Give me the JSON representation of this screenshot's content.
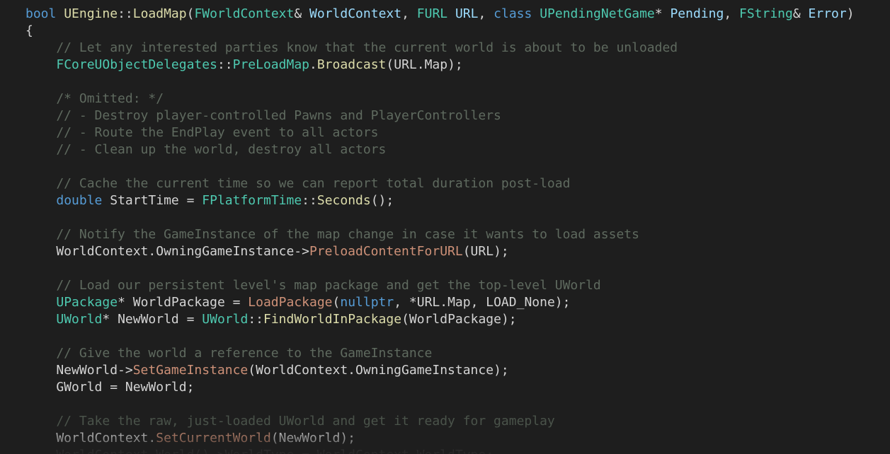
{
  "code_lines": [
    [
      {
        "t": "bool",
        "c": "kw"
      },
      {
        "t": " ",
        "c": "plain"
      },
      {
        "t": "UEngine",
        "c": "fn"
      },
      {
        "t": "::",
        "c": "plain"
      },
      {
        "t": "LoadMap",
        "c": "fn"
      },
      {
        "t": "(",
        "c": "plain"
      },
      {
        "t": "FWorldContext",
        "c": "type"
      },
      {
        "t": "& ",
        "c": "plain"
      },
      {
        "t": "WorldContext",
        "c": "param"
      },
      {
        "t": ", ",
        "c": "plain"
      },
      {
        "t": "FURL",
        "c": "type"
      },
      {
        "t": " ",
        "c": "plain"
      },
      {
        "t": "URL",
        "c": "param"
      },
      {
        "t": ", ",
        "c": "plain"
      },
      {
        "t": "class",
        "c": "kw"
      },
      {
        "t": " ",
        "c": "plain"
      },
      {
        "t": "UPendingNetGame",
        "c": "type"
      },
      {
        "t": "* ",
        "c": "plain"
      },
      {
        "t": "Pending",
        "c": "param"
      },
      {
        "t": ", ",
        "c": "plain"
      },
      {
        "t": "FString",
        "c": "type"
      },
      {
        "t": "& ",
        "c": "plain"
      },
      {
        "t": "Error",
        "c": "param"
      },
      {
        "t": ")",
        "c": "plain"
      }
    ],
    [
      {
        "t": "{",
        "c": "plain"
      }
    ],
    [
      {
        "t": "    // Let any interested parties know that the current world is about to be unloaded",
        "c": "comment"
      }
    ],
    [
      {
        "t": "    ",
        "c": "plain"
      },
      {
        "t": "FCoreUObjectDelegates",
        "c": "type"
      },
      {
        "t": "::",
        "c": "plain"
      },
      {
        "t": "PreLoadMap",
        "c": "type"
      },
      {
        "t": ".",
        "c": "plain"
      },
      {
        "t": "Broadcast",
        "c": "fn"
      },
      {
        "t": "(URL.Map);",
        "c": "plain"
      }
    ],
    [
      {
        "t": "",
        "c": "plain"
      }
    ],
    [
      {
        "t": "    /* Omitted: */",
        "c": "comment"
      }
    ],
    [
      {
        "t": "    // - Destroy player-controlled Pawns and PlayerControllers",
        "c": "comment"
      }
    ],
    [
      {
        "t": "    // - Route the EndPlay event to all actors",
        "c": "comment"
      }
    ],
    [
      {
        "t": "    // - Clean up the world, destroy all actors",
        "c": "comment"
      }
    ],
    [
      {
        "t": "",
        "c": "plain"
      }
    ],
    [
      {
        "t": "    // Cache the current time so we can report total duration post-load",
        "c": "comment"
      }
    ],
    [
      {
        "t": "    ",
        "c": "plain"
      },
      {
        "t": "double",
        "c": "kw"
      },
      {
        "t": " StartTime = ",
        "c": "plain"
      },
      {
        "t": "FPlatformTime",
        "c": "type"
      },
      {
        "t": "::",
        "c": "plain"
      },
      {
        "t": "Seconds",
        "c": "fn"
      },
      {
        "t": "();",
        "c": "plain"
      }
    ],
    [
      {
        "t": "",
        "c": "plain"
      }
    ],
    [
      {
        "t": "    // Notify the GameInstance of the map change in case it wants to load assets",
        "c": "comment"
      }
    ],
    [
      {
        "t": "    WorldContext.OwningGameInstance->",
        "c": "plain"
      },
      {
        "t": "PreloadContentForURL",
        "c": "method"
      },
      {
        "t": "(URL);",
        "c": "plain"
      }
    ],
    [
      {
        "t": "",
        "c": "plain"
      }
    ],
    [
      {
        "t": "    // Load our persistent level's map package and get the top-level UWorld",
        "c": "comment"
      }
    ],
    [
      {
        "t": "    ",
        "c": "plain"
      },
      {
        "t": "UPackage",
        "c": "type"
      },
      {
        "t": "* WorldPackage = ",
        "c": "plain"
      },
      {
        "t": "LoadPackage",
        "c": "method"
      },
      {
        "t": "(",
        "c": "plain"
      },
      {
        "t": "nullptr",
        "c": "kw"
      },
      {
        "t": ", *URL.Map, LOAD_None);",
        "c": "plain"
      }
    ],
    [
      {
        "t": "    ",
        "c": "plain"
      },
      {
        "t": "UWorld",
        "c": "type"
      },
      {
        "t": "* NewWorld = ",
        "c": "plain"
      },
      {
        "t": "UWorld",
        "c": "type"
      },
      {
        "t": "::",
        "c": "plain"
      },
      {
        "t": "FindWorldInPackage",
        "c": "fn"
      },
      {
        "t": "(WorldPackage);",
        "c": "plain"
      }
    ],
    [
      {
        "t": "",
        "c": "plain"
      }
    ],
    [
      {
        "t": "    // Give the world a reference to the GameInstance",
        "c": "comment"
      }
    ],
    [
      {
        "t": "    NewWorld->",
        "c": "plain"
      },
      {
        "t": "SetGameInstance",
        "c": "method"
      },
      {
        "t": "(WorldContext.OwningGameInstance);",
        "c": "plain"
      }
    ],
    [
      {
        "t": "    GWorld = NewWorld;",
        "c": "plain"
      }
    ],
    [
      {
        "t": "",
        "c": "plain"
      }
    ],
    [
      {
        "t": "    // Take the raw, just-loaded UWorld and get it ready for gameplay",
        "c": "comment-faint"
      }
    ],
    [
      {
        "t": "    WorldContext.",
        "c": "plain"
      },
      {
        "t": "SetCurrentWorld",
        "c": "method"
      },
      {
        "t": "(NewWorld);",
        "c": "plain"
      }
    ],
    [
      {
        "t": "    WorldContext.World()->WorldType = WorldContext.WorldType;",
        "c": "faint"
      }
    ]
  ]
}
